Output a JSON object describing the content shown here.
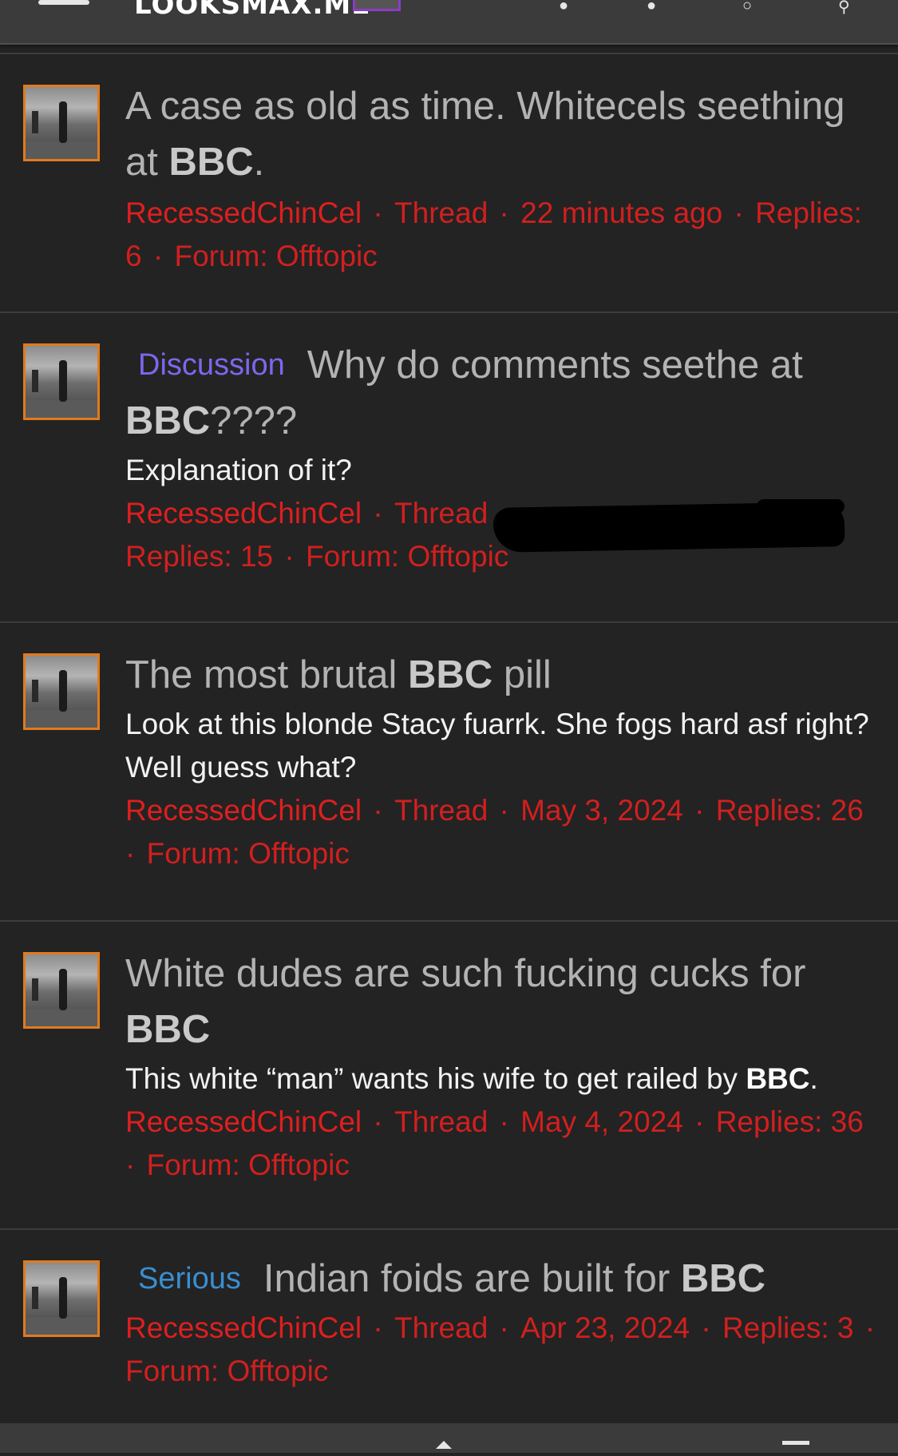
{
  "header": {
    "logo_text": "LOOKSMAX.ME",
    "menu_icon": "hamburger-menu-icon",
    "logo_badge_icon": "avatar-badge-icon"
  },
  "threads": [
    {
      "title_parts": [
        "A case as old as time. Whitecels seething at ",
        "BBC",
        "."
      ],
      "prefix": "",
      "snippet": "",
      "author": "RecessedChinCel",
      "type": "Thread",
      "time": "22 minutes ago",
      "replies": "Replies: 6",
      "forum": "Forum: Offtopic"
    },
    {
      "title_parts": [
        "Why do comments seethe at ",
        "BBC",
        "????"
      ],
      "prefix": "Discussion",
      "snippet": "Explanation of it?",
      "author": "RecessedChinCel",
      "type": "Thread",
      "time": "",
      "replies": "Replies: 15",
      "forum": "Forum: Offtopic"
    },
    {
      "title_parts": [
        "The most brutal ",
        "BBC",
        " pill"
      ],
      "prefix": "",
      "snippet": "Look at this blonde Stacy fuarrk. She fogs hard asf right? Well guess what?",
      "author": "RecessedChinCel",
      "type": "Thread",
      "time": "May 3, 2024",
      "replies": "Replies: 26",
      "forum": "Forum: Offtopic"
    },
    {
      "title_parts": [
        "White dudes are such fucking cucks for ",
        "BBC",
        ""
      ],
      "prefix": "",
      "snippet_parts": [
        "This white “man” wants his wife to get railed by ",
        "BBC",
        "."
      ],
      "author": "RecessedChinCel",
      "type": "Thread",
      "time": "May 4, 2024",
      "replies": "Replies: 36",
      "forum": "Forum: Offtopic"
    },
    {
      "title_parts": [
        "Indian foids are built for ",
        "BBC",
        ""
      ],
      "prefix": "Serious",
      "snippet": "",
      "author": "RecessedChinCel",
      "type": "Thread",
      "time": "Apr 23, 2024",
      "replies": "Replies: 3",
      "forum": "Forum: Offtopic"
    }
  ],
  "colors": {
    "background": "#232323",
    "meta_red": "#d21f1f",
    "avatar_border": "#e07a1f",
    "discussion_prefix": "#7b68ee",
    "serious_prefix": "#3a8ed0"
  }
}
